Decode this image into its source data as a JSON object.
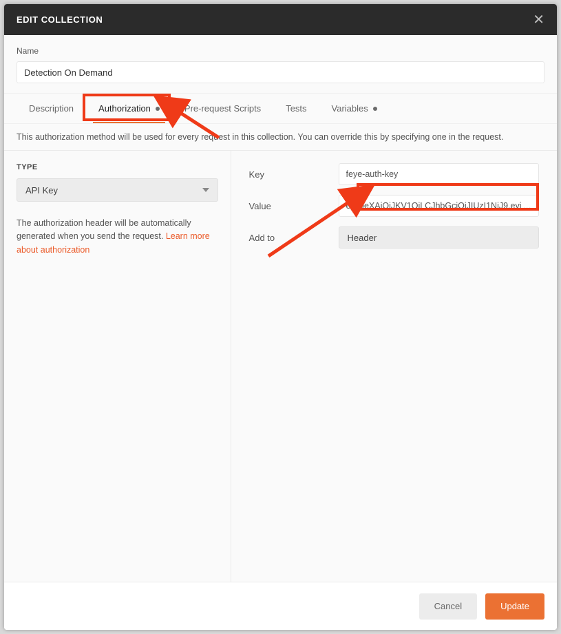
{
  "modal": {
    "title": "EDIT COLLECTION"
  },
  "name": {
    "label": "Name",
    "value": "Detection On Demand"
  },
  "tabs": {
    "description": "Description",
    "authorization": "Authorization",
    "prerequest": "Pre-request Scripts",
    "tests": "Tests",
    "variables": "Variables"
  },
  "help": {
    "text": "This authorization method will be used for every request in this collection. You can override this by specifying one in the request."
  },
  "left": {
    "type_label": "TYPE",
    "type_value": "API Key",
    "help_1": "The authorization header will be automatically generated when you send the request. ",
    "link": "Learn more about authorization"
  },
  "right": {
    "key_label": "Key",
    "key_value": "feye-auth-key",
    "value_label": "Value",
    "value_value": "eyJ0eXAiOiJKV1QiLCJhbGciOiJIUzI1NiJ9.eyj",
    "addto_label": "Add to",
    "addto_value": "Header"
  },
  "footer": {
    "cancel": "Cancel",
    "update": "Update"
  }
}
